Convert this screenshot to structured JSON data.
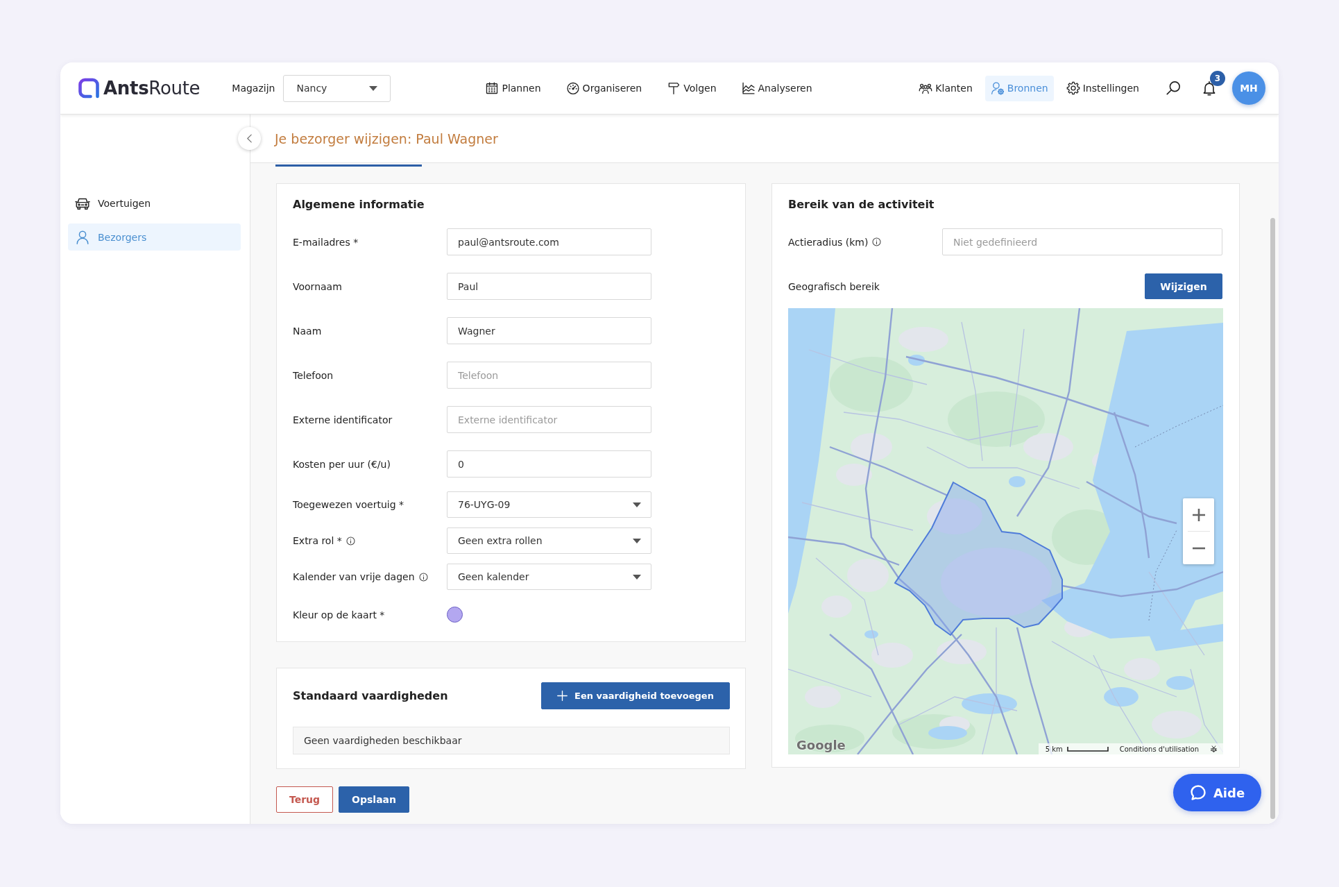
{
  "header": {
    "logo": "**Ants**Route",
    "warehouse": {
      "label": "Magazijn",
      "value": "Nancy"
    },
    "nav": [
      {
        "label": "Plannen",
        "selected": false
      },
      {
        "label": "Organiseren",
        "selected": false
      },
      {
        "label": "Volgen",
        "selected": false
      },
      {
        "label": "Analyseren",
        "selected": false
      }
    ],
    "nav_right": [
      {
        "label": "Klanten",
        "selected": false
      },
      {
        "label": "Bronnen",
        "selected": true
      },
      {
        "label": "Instellingen",
        "selected": false
      }
    ],
    "notifications": {
      "count": "3"
    },
    "user": {
      "initials": "MH"
    }
  },
  "sidebar": {
    "items": [
      {
        "label": "Voertuigen",
        "selected": false
      },
      {
        "label": "Bezorgers",
        "selected": true
      }
    ]
  },
  "page": {
    "title": "Je bezorger wijzigen: Paul Wagner"
  },
  "general": {
    "title": "Algemene informatie",
    "fields": [
      {
        "kind": "text",
        "label": "E-mailadres *",
        "info": false,
        "value": "paul@antsroute.com"
      },
      {
        "kind": "text",
        "label": "Voornaam",
        "info": false,
        "value": "Paul"
      },
      {
        "kind": "text",
        "label": "Naam",
        "info": false,
        "value": "Wagner"
      },
      {
        "kind": "text",
        "label": "Telefoon",
        "info": false,
        "placeholder": "Telefoon"
      },
      {
        "kind": "text",
        "label": "Externe identificator",
        "info": false,
        "placeholder": "Externe identificator"
      },
      {
        "kind": "text",
        "label": "Kosten per uur (€/u)",
        "info": false,
        "value": "0"
      },
      {
        "kind": "select",
        "label": "Toegewezen voertuig *",
        "info": false,
        "value": "76-UYG-09"
      },
      {
        "kind": "select",
        "label": "Extra rol *",
        "info": true,
        "value": "Geen extra rollen"
      },
      {
        "kind": "select",
        "label": "Kalender van vrije dagen",
        "info": true,
        "value": "Geen kalender"
      },
      {
        "kind": "color",
        "label": "Kleur op de kaart *",
        "info": false,
        "color": "#b3a7f0"
      }
    ]
  },
  "skills": {
    "title": "Standaard vaardigheden",
    "add_button": "Een vaardigheid toevoegen",
    "empty_text": "Geen vaardigheden beschikbaar"
  },
  "actions": [
    {
      "kind": "secondary",
      "label": "Terug"
    },
    {
      "kind": "primary",
      "label": "Opslaan"
    }
  ],
  "area": {
    "title": "Bereik van de activiteit",
    "radius": {
      "label": "Actieradius (km)",
      "info": true,
      "placeholder": "Niet gedefinieerd"
    },
    "geo_label": "Geografisch bereik",
    "edit_button": "Wijzigen",
    "map": {
      "logo": "Google",
      "scale": "5 km",
      "terms": "Conditions d'utilisation"
    }
  },
  "help_button": {
    "label": "Aide"
  }
}
